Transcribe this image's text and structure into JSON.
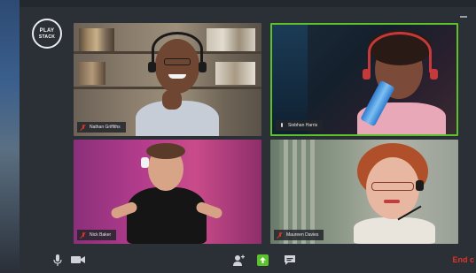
{
  "app": {
    "logo_line1": "PLAY",
    "logo_line2": "STACK"
  },
  "participants": [
    {
      "name": "Nathan Griffiths",
      "muted": true,
      "active": false
    },
    {
      "name": "Siobhan Harris",
      "muted": false,
      "active": true
    },
    {
      "name": "Nick Baker",
      "muted": true,
      "active": false
    },
    {
      "name": "Maureen Davies",
      "muted": true,
      "active": false
    }
  ],
  "toolbar": {
    "end_label": "End c",
    "icons": [
      "microphone-icon",
      "camera-icon",
      "add-user-icon",
      "share-screen-icon",
      "chat-icon"
    ]
  },
  "colors": {
    "active_speaker_border": "#5cc22c",
    "end_call": "#e0332a",
    "muted_mic": "#d9342b",
    "share_button": "#5cc22c"
  }
}
